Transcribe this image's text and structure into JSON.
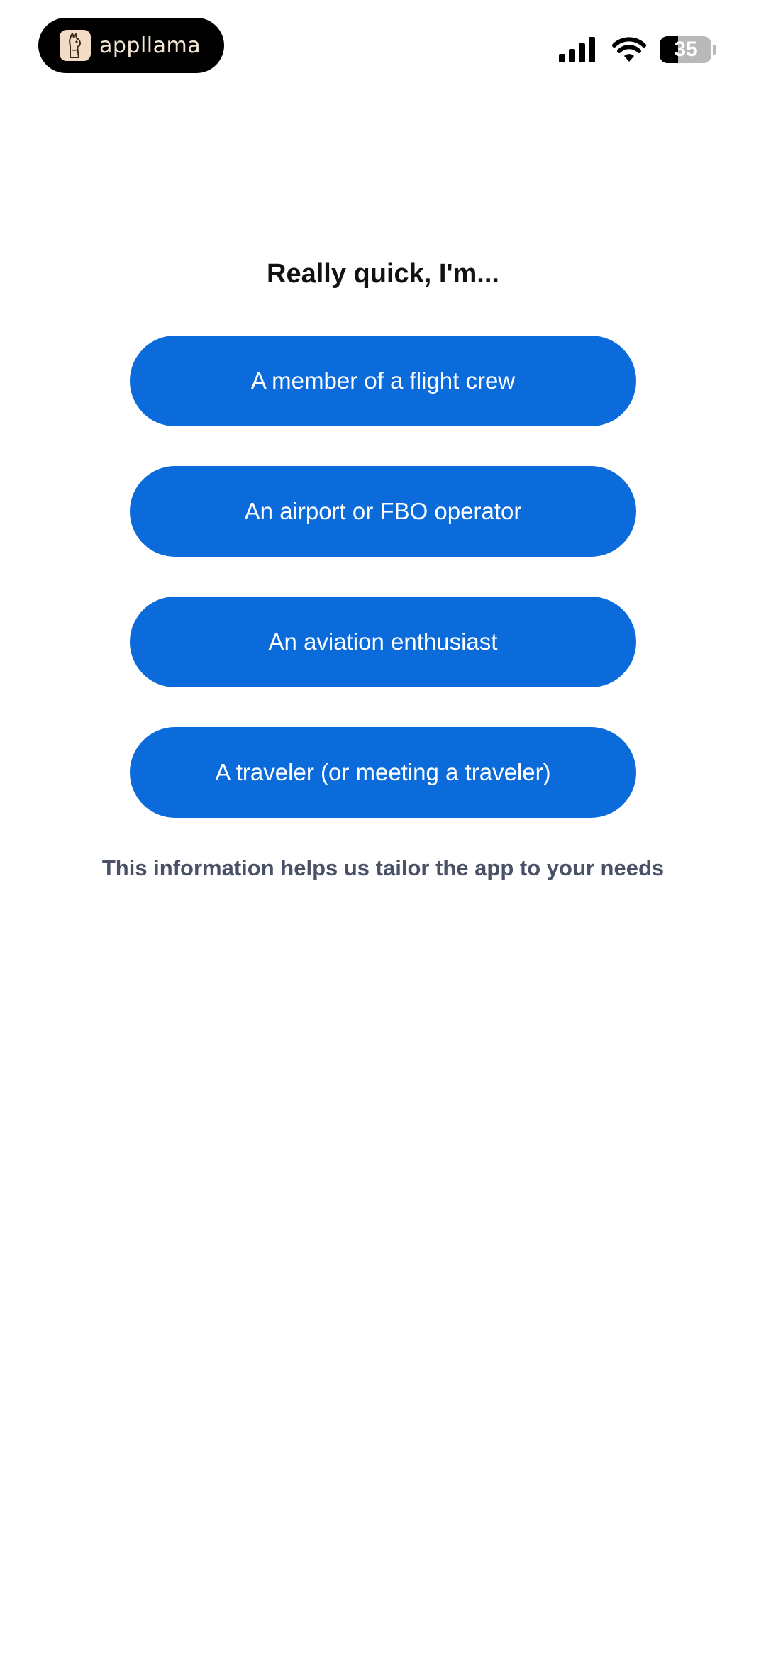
{
  "status_bar": {
    "brand_name": "appllama",
    "battery_level": "35",
    "battery_fraction": 0.35,
    "icons": [
      "llama-logo-icon",
      "cellular-signal-icon",
      "wifi-icon",
      "battery-icon"
    ]
  },
  "onboarding": {
    "title": "Really quick, I'm...",
    "options": [
      {
        "label": "A member of a flight crew"
      },
      {
        "label": "An airport or FBO operator"
      },
      {
        "label": "An aviation enthusiast"
      },
      {
        "label": "A traveler (or meeting a traveler)"
      }
    ],
    "helper_text": "This information helps us tailor the app to your needs"
  },
  "colors": {
    "button_background": "#0b6bdb",
    "button_text": "#ffffff",
    "title_text": "#111111",
    "helper_text": "#4a5066",
    "background": "#ffffff"
  }
}
